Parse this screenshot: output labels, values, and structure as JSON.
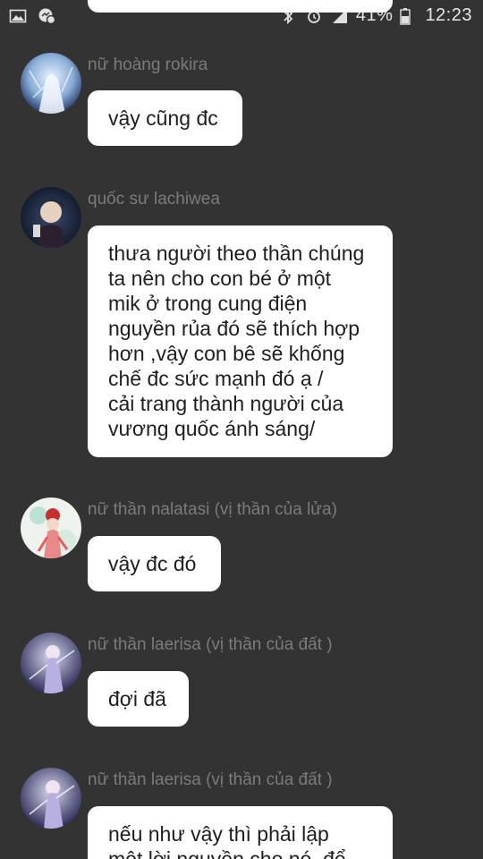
{
  "status_bar": {
    "battery_text": "41%",
    "time": "12:23",
    "icons": [
      "gallery-icon",
      "messenger-icon",
      "bluetooth-icon",
      "alarm-icon",
      "signal-icon",
      "battery-icon"
    ]
  },
  "messages": [
    {
      "sender": "nữ hoàng rokira",
      "text": "vậy cũng đc",
      "avatar": "avatar-rokira"
    },
    {
      "sender": "quốc sư lachiwea",
      "text": "thưa người theo thần chúng\nta nên cho con bé ở một\nmik ở trong cung điện\nnguyền rủa đó sẽ thích hợp\nhơn ,vậy con bê sẽ khống\nchế đc sức mạnh đó ạ /\ncải trang thành người của\nvương quốc ánh sáng/",
      "avatar": "avatar-lachiwea"
    },
    {
      "sender": "nữ thần nalatasi (vị thần của lửa)",
      "text": "vậy đc đó",
      "avatar": "avatar-nalatasi"
    },
    {
      "sender": "nữ thần laerisa (vị thần của đất )",
      "text": "đợi đã",
      "avatar": "avatar-laerisa"
    },
    {
      "sender": "nữ thần laerisa (vị thần của đất )",
      "text": "nếu như vậy thì phải lập\nmột lời nguyền cho nó, để",
      "avatar": "avatar-laerisa"
    }
  ],
  "colors": {
    "background": "#333333",
    "bubble": "#ffffff",
    "sender_text": "#7b7b7b",
    "message_text": "#1e1e1e"
  }
}
